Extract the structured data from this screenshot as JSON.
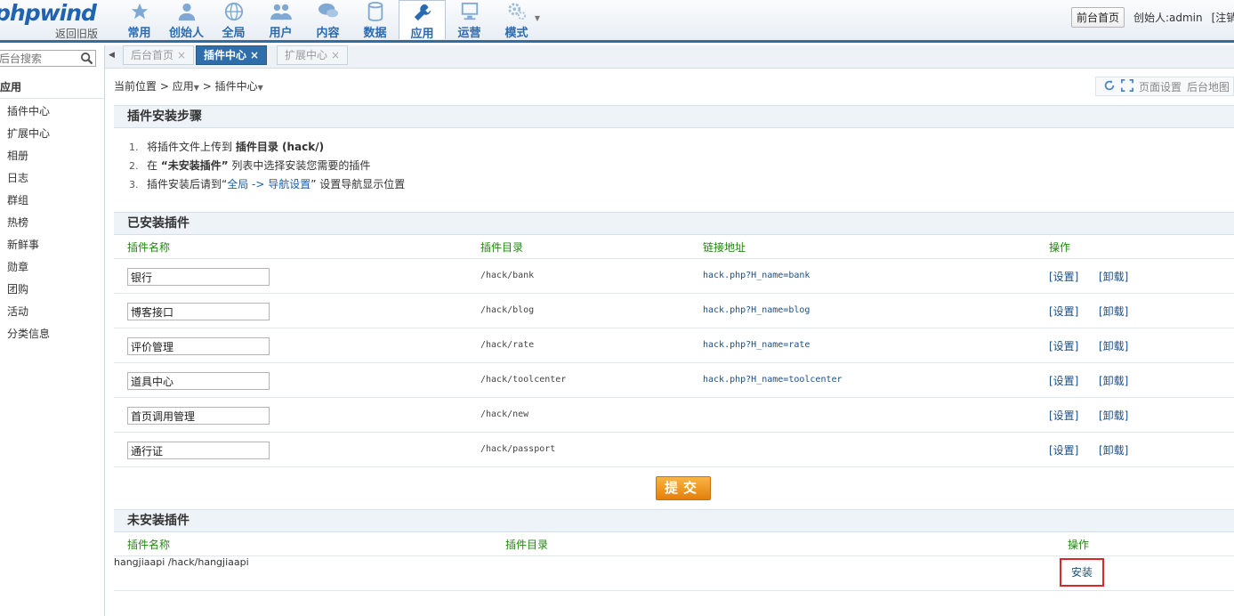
{
  "header": {
    "brand": "phpwind",
    "old_version": "返回旧版",
    "nav": [
      {
        "label": "常用",
        "icon": "star-icon"
      },
      {
        "label": "创始人",
        "icon": "person-icon"
      },
      {
        "label": "全局",
        "icon": "globe-icon"
      },
      {
        "label": "用户",
        "icon": "users-icon"
      },
      {
        "label": "内容",
        "icon": "chat-icon"
      },
      {
        "label": "数据",
        "icon": "database-icon"
      },
      {
        "label": "应用",
        "icon": "wrench-icon"
      },
      {
        "label": "运营",
        "icon": "monitor-icon"
      },
      {
        "label": "模式",
        "icon": "gears-icon"
      }
    ],
    "active_nav": "应用",
    "front_home": "前台首页",
    "creator": "创始人:admin",
    "logout": "[注销]"
  },
  "sidebar": {
    "search_placeholder": "后台搜索",
    "title": "应用",
    "items": [
      "插件中心",
      "扩展中心",
      "相册",
      "日志",
      "群组",
      "热榜",
      "新鲜事",
      "勋章",
      "团购",
      "活动",
      "分类信息"
    ]
  },
  "tabs": [
    {
      "label": "后台首页",
      "active": false
    },
    {
      "label": "插件中心",
      "active": true
    },
    {
      "label": "扩展中心",
      "active": false
    }
  ],
  "breadcrumb": {
    "prefix": "当前位置",
    "level1": "应用",
    "level2": "插件中心"
  },
  "page_tools": {
    "settings": "页面设置",
    "map": "后台地图"
  },
  "steps": {
    "title": "插件安装步骤",
    "items": [
      {
        "num": "1.",
        "pre": "将插件文件上传到 ",
        "bold": "插件目录 (hack/)",
        "post": ""
      },
      {
        "num": "2.",
        "pre": "在 ",
        "bold": "“未安装插件”",
        "post": " 列表中选择安装您需要的插件"
      },
      {
        "num": "3.",
        "pre": "插件安装后请到“",
        "link": "全局 -> 导航设置",
        "post": "” 设置导航显示位置"
      }
    ]
  },
  "installed": {
    "title": "已安装插件",
    "columns": [
      "插件名称",
      "插件目录",
      "链接地址",
      "操作"
    ],
    "rows": [
      {
        "name": "银行",
        "dir": "/hack/bank",
        "link": "hack.php?H_name=bank"
      },
      {
        "name": "博客接口",
        "dir": "/hack/blog",
        "link": "hack.php?H_name=blog"
      },
      {
        "name": "评价管理",
        "dir": "/hack/rate",
        "link": "hack.php?H_name=rate"
      },
      {
        "name": "道具中心",
        "dir": "/hack/toolcenter",
        "link": "hack.php?H_name=toolcenter"
      },
      {
        "name": "首页调用管理",
        "dir": "/hack/new",
        "link": ""
      },
      {
        "name": "通行证",
        "dir": "/hack/passport",
        "link": ""
      }
    ],
    "op_settings": "[设置]",
    "op_uninstall": "[卸载]",
    "submit": "提交"
  },
  "uninstalled": {
    "title": "未安装插件",
    "columns": [
      "插件名称",
      "插件目录",
      "操作"
    ],
    "rows": [
      {
        "name": "hangjiaapi",
        "dir": "/hack/hangjiaapi",
        "op": "安装"
      }
    ]
  }
}
